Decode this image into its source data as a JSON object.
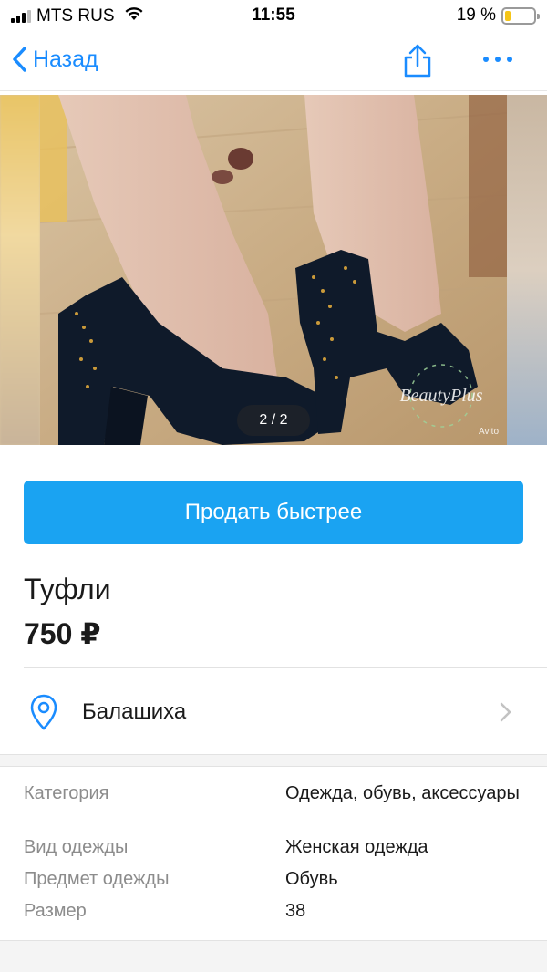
{
  "status_bar": {
    "carrier": "MTS RUS",
    "time": "11:55",
    "battery_percent": "19 %",
    "battery_level": 0.19
  },
  "nav": {
    "back_label": "Назад",
    "share_icon": "share-icon",
    "more_icon": "more-dots-icon",
    "accent_color": "#1a8cff"
  },
  "gallery": {
    "counter": "2 / 2",
    "watermark": "BeautyPlus",
    "watermark_small": "Avito"
  },
  "actions": {
    "sell_faster_label": "Продать быстрее",
    "button_color": "#1aa3f2"
  },
  "listing": {
    "title": "Туфли",
    "price": "750 ₽",
    "location": "Балашиха"
  },
  "params": [
    {
      "key": "Категория",
      "value": "Одежда, обувь, аксессуары"
    },
    {
      "key": "Вид одежды",
      "value": "Женская одежда"
    },
    {
      "key": "Предмет одежды",
      "value": "Обувь"
    },
    {
      "key": "Размер",
      "value": "38"
    }
  ]
}
